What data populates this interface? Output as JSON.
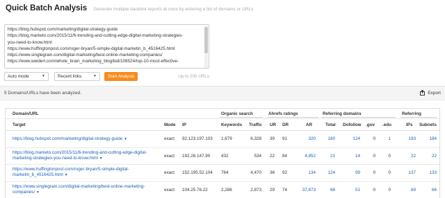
{
  "header": {
    "title": "Quick Batch Analysis",
    "subtitle": "Generate multiple backlink reports at once by entering a list of domains or URLs"
  },
  "textarea": {
    "lines": [
      "https://blog.hubspot.com/marketing/digital-strategy-guide",
      "https://blog.marketo.com/2015/11/6-trending-and-cutting-edge-digital-marketing-strategies-",
      "you-need-to-know.html",
      "https://www.huffingtonpost.com/roger-bryan/5-simple-digital-marketin_b_4516425.html",
      "https://www.singlegrain.com/digital-marketing/best-online-marketing-companies/",
      "https://www.weidert.com/whole_brain_marketing_blog/bid/108524/top-10-most-effective-"
    ]
  },
  "controls": {
    "mode": "Auto mode",
    "links": "Recent links",
    "start": "Start Analysis",
    "limit": "Up to 200 URLs"
  },
  "status": {
    "text": "5 Domains/URLs have been analyzed.",
    "export": "Export"
  },
  "table": {
    "groups": {
      "domain": "Domain/URL",
      "organic": "Organic search",
      "ahrefs": "Ahrefs ratings",
      "refdomains": "Referring domains",
      "referring": "Referring"
    },
    "headers": {
      "target": "Target",
      "mode": "Mode",
      "ip": "IP",
      "keywords": "Keywords",
      "traffic": "Traffic",
      "ur": "UR",
      "dr": "DR",
      "ar": "AR",
      "total": "Total",
      "dofollow": "Dofollow",
      "gov": ".gov",
      "edu": ".edu",
      "ips": "IPs",
      "subnets": "Subnets"
    },
    "rows": [
      {
        "target_l1": "https://blog.hubspot.com/marketing/digital-strategy-guide",
        "target_l2": "",
        "mode": "exact",
        "ip": "92.123.197.103",
        "keywords": "1,679",
        "traffic": "6,328",
        "ur": "39",
        "dr": "91",
        "ar": "320",
        "total": "180",
        "dofollow": "124",
        "gov": "0",
        "edu": "1",
        "ips": "193",
        "subnets": "184"
      },
      {
        "target_l1": "https://blog.marketo.com/2015/11/6-trending-and-cutting-edge-digital-",
        "target_l2": "marketing-strategies-you-need-to-know.html",
        "mode": "exact",
        "ip": "192.28.147.90",
        "keywords": "432",
        "traffic": "534",
        "ur": "22",
        "dr": "84",
        "ar": "4,852",
        "total": "21",
        "dofollow": "14",
        "gov": "0",
        "edu": "0",
        "ips": "22",
        "subnets": "22"
      },
      {
        "target_l1": "https://www.huffingtonpost.com/roger-bryan/5-simple-digital-",
        "target_l2": "marketin_b_4516425.html",
        "mode": "exact",
        "ip": "152.195.52.104",
        "keywords": "764",
        "traffic": "4,470",
        "ur": "36",
        "dr": "92",
        "ar": "134",
        "total": "124",
        "dofollow": "99",
        "gov": "0",
        "edu": "0",
        "ips": "137",
        "subnets": "133"
      },
      {
        "target_l1": "https://www.singlegrain.com/digital-marketing/best-online-marketing-",
        "target_l2": "companies/",
        "mode": "exact",
        "ip": "104.25.76.22",
        "keywords": "2,286",
        "traffic": "2,873",
        "ur": "29",
        "dr": "74",
        "ar": "37,873",
        "total": "66",
        "dofollow": "51",
        "gov": "0",
        "edu": "0",
        "ips": "69",
        "subnets": "66"
      }
    ]
  },
  "colors": {
    "accent": "#f68b1f",
    "link": "#1a5fb4"
  }
}
